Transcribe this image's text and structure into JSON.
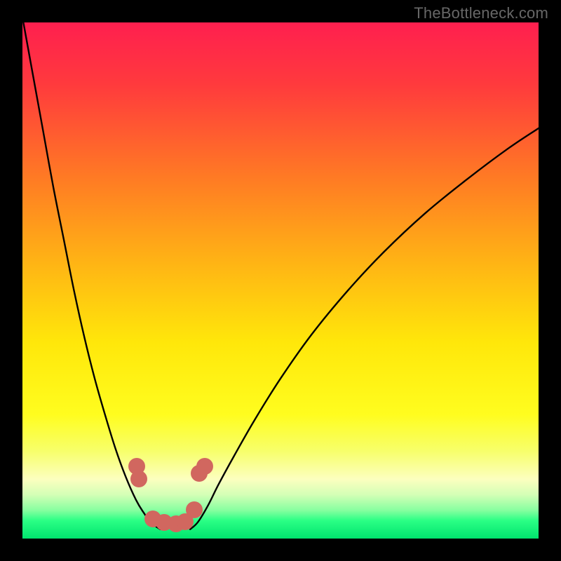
{
  "watermark": "TheBottleneck.com",
  "chart_data": {
    "type": "line",
    "title": "",
    "xlabel": "",
    "ylabel": "",
    "xlim": [
      0,
      100
    ],
    "ylim": [
      0,
      100
    ],
    "series": [
      {
        "name": "left-curve",
        "x": [
          0,
          2,
          4,
          6,
          8,
          10,
          12,
          14,
          16,
          18,
          20,
          22,
          23.5,
          25,
          26.7
        ],
        "y": [
          101,
          90,
          79,
          68,
          58,
          48,
          39,
          31,
          24,
          17.5,
          12,
          7.5,
          5,
          3,
          1.8
        ]
      },
      {
        "name": "right-curve",
        "x": [
          32.5,
          34,
          36,
          38,
          41,
          45,
          50,
          56,
          63,
          70,
          78,
          86,
          94,
          100
        ],
        "y": [
          1.8,
          3.2,
          6.5,
          10.5,
          16,
          23,
          31,
          39.5,
          48,
          55.5,
          63,
          69.5,
          75.5,
          79.5
        ]
      },
      {
        "name": "bottom-green-band",
        "x": [
          0,
          100
        ],
        "y": [
          3.8,
          3.8
        ]
      }
    ],
    "gradient_stops": [
      {
        "pos": 0.0,
        "color": "#ff1f4f"
      },
      {
        "pos": 0.12,
        "color": "#ff3a3d"
      },
      {
        "pos": 0.3,
        "color": "#ff7a24"
      },
      {
        "pos": 0.46,
        "color": "#ffb215"
      },
      {
        "pos": 0.62,
        "color": "#ffe70a"
      },
      {
        "pos": 0.76,
        "color": "#fffd1f"
      },
      {
        "pos": 0.83,
        "color": "#f7ff6a"
      },
      {
        "pos": 0.885,
        "color": "#fcffbf"
      },
      {
        "pos": 0.915,
        "color": "#d4ffb6"
      },
      {
        "pos": 0.945,
        "color": "#87ffa0"
      },
      {
        "pos": 0.965,
        "color": "#2bff85"
      },
      {
        "pos": 1.0,
        "color": "#00e46e"
      }
    ],
    "dots": {
      "color": "#d1675f",
      "radius": 12,
      "points": [
        {
          "x": 22.1,
          "y": 14.0
        },
        {
          "x": 22.6,
          "y": 11.5
        },
        {
          "x": 25.3,
          "y": 3.8
        },
        {
          "x": 27.5,
          "y": 3.1
        },
        {
          "x": 29.8,
          "y": 2.9
        },
        {
          "x": 31.5,
          "y": 3.3
        },
        {
          "x": 33.3,
          "y": 5.6
        },
        {
          "x": 34.3,
          "y": 12.6
        },
        {
          "x": 35.3,
          "y": 14.0
        }
      ]
    }
  }
}
